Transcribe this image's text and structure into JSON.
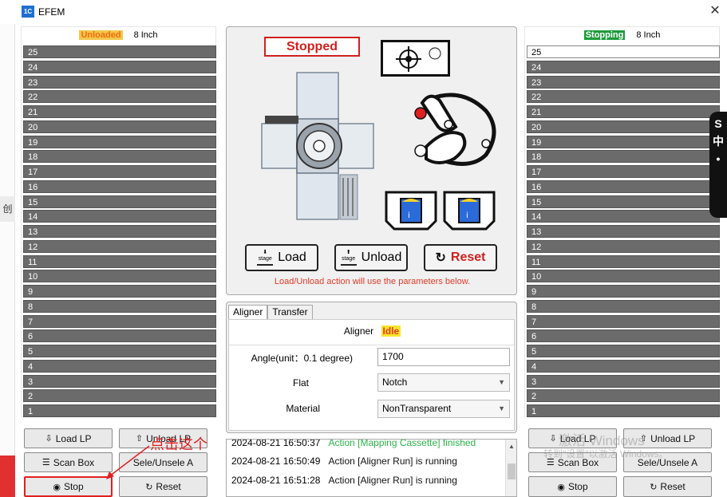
{
  "window": {
    "title": "EFEM",
    "icon_text": "1C"
  },
  "background": {
    "tab_char": "创"
  },
  "left_port": {
    "status": "Unloaded",
    "size": "8 Inch",
    "slots": [
      "25",
      "24",
      "23",
      "22",
      "21",
      "20",
      "19",
      "18",
      "17",
      "16",
      "15",
      "14",
      "13",
      "12",
      "11",
      "10",
      "9",
      "8",
      "7",
      "6",
      "5",
      "4",
      "3",
      "2",
      "1"
    ],
    "buttons": {
      "load": "Load LP",
      "unload": "Unload LP",
      "scan": "Scan Box",
      "select": "Sele/Unsele A",
      "stop": "Stop",
      "reset": "Reset"
    }
  },
  "right_port": {
    "status": "Stopping",
    "size": "8 Inch",
    "slots": [
      "25",
      "24",
      "23",
      "22",
      "21",
      "20",
      "19",
      "18",
      "17",
      "16",
      "15",
      "14",
      "13",
      "12",
      "11",
      "10",
      "9",
      "8",
      "7",
      "6",
      "5",
      "4",
      "3",
      "2",
      "1"
    ],
    "buttons": {
      "load": "Load LP",
      "unload": "Unload LP",
      "scan": "Scan Box",
      "select": "Sele/Unsele A",
      "stop": "Stop",
      "reset": "Reset"
    }
  },
  "center": {
    "state": "Stopped",
    "stage_icon_text": "stage",
    "buttons": {
      "load": "Load",
      "unload": "Unload",
      "reset": "Reset"
    },
    "hint": "Load/Unload action will use the parameters below."
  },
  "params": {
    "tabs": [
      "Aligner",
      "Transfer"
    ],
    "aligner_label": "Aligner",
    "aligner_status": "Idle",
    "angle_label": "Angle(unit：0.1 degree)",
    "angle_value": "1700",
    "flat_label": "Flat",
    "flat_value": "Notch",
    "material_label": "Material",
    "material_value": "NonTransparent"
  },
  "log": [
    {
      "time": "2024-08-21 16:50:37",
      "msg": "Action [Mapping Cassette] finished",
      "color": "#2bb34a"
    },
    {
      "time": "2024-08-21 16:50:49",
      "msg": "Action [Aligner Run] is running",
      "color": "#111111"
    },
    {
      "time": "2024-08-21 16:51:28",
      "msg": "Action [Aligner Run] is running",
      "color": "#111111"
    }
  ],
  "annotation": {
    "text": "点击这个"
  },
  "watermark": {
    "line1": "激活 Windows",
    "line2": "转到\"设置\"以激活 Windows。"
  },
  "side_widget": {
    "chars": [
      "S",
      "中",
      "•"
    ]
  },
  "colors": {
    "slot_gray": "#6b6b6b",
    "stopped_red": "#d02020",
    "accent_yellow": "#f2c84c",
    "stopping_green": "#1f9b3c"
  }
}
